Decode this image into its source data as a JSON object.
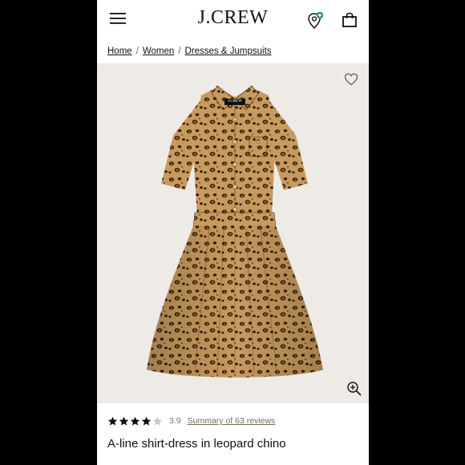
{
  "header": {
    "logo_text": "J.CREW"
  },
  "breadcrumb": {
    "items": [
      {
        "label": "Home"
      },
      {
        "label": "Women"
      },
      {
        "label": "Dresses & Jumpsuits"
      }
    ],
    "separator": "/"
  },
  "product": {
    "image_label": "J.CREW",
    "rating_value": "3.9",
    "rating_stars": 3.9,
    "reviews_link": "Summary of 63 reviews",
    "title": "A-line shirt-dress in leopard chino"
  },
  "colors": {
    "background_outer": "#000000",
    "page_background": "#ffffff",
    "image_background": "#eeeae6",
    "review_link": "#7a6a4f",
    "cart_badge": "#2e8b57"
  }
}
